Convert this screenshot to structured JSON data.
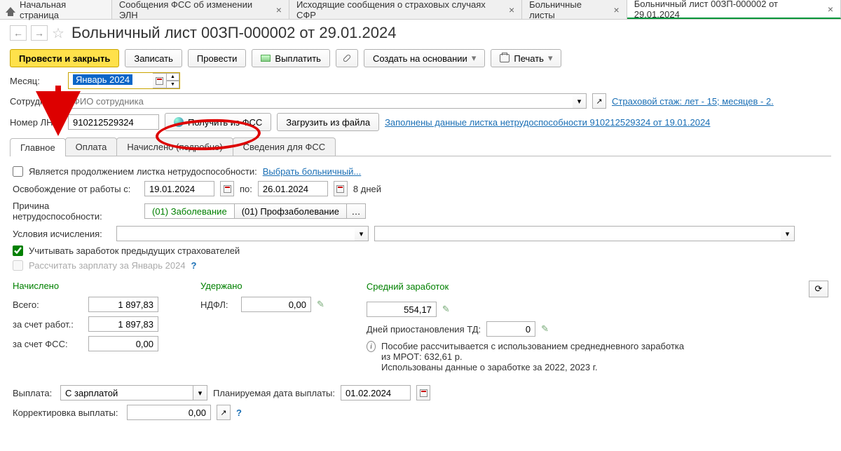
{
  "tabs": {
    "home": "Начальная страница",
    "t1": "Сообщения ФСС об изменении ЭЛН",
    "t2": "Исходящие сообщения о страховых случаях СФР",
    "t3": "Больничные листы",
    "t4": "Больничный лист 00ЗП-000002 от 29.01.2024"
  },
  "title": "Больничный лист 00ЗП-000002 от 29.01.2024",
  "toolbar": {
    "post_close": "Провести и закрыть",
    "save": "Записать",
    "post": "Провести",
    "pay": "Выплатить",
    "create_based": "Создать на основании",
    "print": "Печать"
  },
  "month": {
    "label": "Месяц:",
    "value": "Январь 2024"
  },
  "employee": {
    "label": "Сотрудник:",
    "placeholder": "ФИО сотрудника"
  },
  "ln": {
    "label": "Номер ЛН:",
    "value": "910212529324",
    "get_fss": "Получить из ФСС",
    "load_file": "Загрузить из файла",
    "info_link": "Заполнены данные листка нетрудоспособности 910212529324 от 19.01.2024"
  },
  "stazh_link": "Страховой стаж: лет - 15; месяцев - 2.",
  "tabs2": {
    "main": "Главное",
    "pay": "Оплата",
    "accrued": "Начислено (подробно)",
    "fss": "Сведения для ФСС"
  },
  "main": {
    "continuation": "Является продолжением листка нетрудоспособности:",
    "choose_sick": "Выбрать больничный...",
    "release_from": "Освобождение от работы с:",
    "date_from": "19.01.2024",
    "po": "по:",
    "date_to": "26.01.2024",
    "days": "8 дней",
    "reason": "Причина нетрудоспособности:",
    "reason1": "(01) Заболевание",
    "reason2": "(01) Профзаболевание",
    "conditions": "Условия исчисления:",
    "prev_insurers": "Учитывать заработок предыдущих страхователей",
    "recalc_salary": "Рассчитать зарплату за Январь 2024",
    "accrued_h": "Начислено",
    "withheld_h": "Удержано",
    "avg_h": "Средний заработок",
    "total": "Всего:",
    "total_v": "1 897,83",
    "by_employer": "за счет работ.:",
    "by_employer_v": "1 897,83",
    "by_fss": "за счет ФСС:",
    "by_fss_v": "0,00",
    "ndfl": "НДФЛ:",
    "ndfl_v": "0,00",
    "avg_v": "554,17",
    "suspension": "Дней приостановления ТД:",
    "suspension_v": "0",
    "info_text": "Пособие рассчитывается с использованием среднедневного заработка из МРОТ: 632,61 р.\nИспользованы данные о заработке за 2022, 2023 г.",
    "payout": "Выплата:",
    "payout_v": "С зарплатой",
    "planned_date": "Планируемая дата выплаты:",
    "planned_date_v": "01.02.2024",
    "correction": "Корректировка выплаты:",
    "correction_v": "0,00"
  }
}
